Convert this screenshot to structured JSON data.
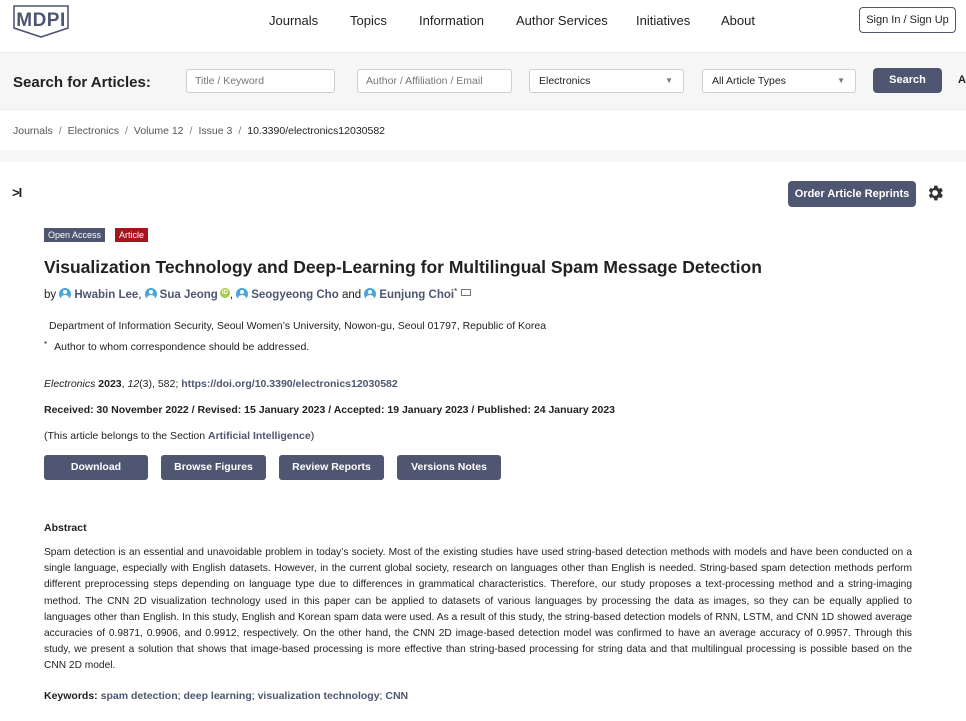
{
  "brand": {
    "logo_text": "MDPI",
    "accent": "#4f5671",
    "article_badge_color": "#a6141e"
  },
  "nav": {
    "items": [
      "Journals",
      "Topics",
      "Information",
      "Author Services",
      "Initiatives",
      "About"
    ],
    "signin": "Sign In / Sign Up"
  },
  "search": {
    "label": "Search for Articles:",
    "title_placeholder": "Title / Keyword",
    "author_placeholder": "Author / Affiliation / Email",
    "journal_value": "Electronics",
    "type_value": "All Article Types",
    "button": "Search",
    "cutoff": "A"
  },
  "breadcrumb": [
    "Journals",
    "Electronics",
    "Volume 12",
    "Issue 3",
    "10.3390/electronics12030582"
  ],
  "tools": {
    "toggle": ">I",
    "order_reprints": "Order Article Reprints"
  },
  "badges": {
    "open_access": "Open Access",
    "type": "Article"
  },
  "article": {
    "title": "Visualization Technology and Deep-Learning for Multilingual Spam Message Detection",
    "by": "by",
    "authors": [
      "Hwabin Lee",
      "Sua Jeong",
      "Seogyeong Cho",
      "Eunjung Choi"
    ],
    "and": "and",
    "corr_mark": "*",
    "orcid_mark": "iD",
    "affiliation": "Department of Information Security, Seoul Women’s University, Nowon-gu, Seoul 01797, Republic of Korea",
    "correspondence": "Author to whom correspondence should be addressed.",
    "citation": {
      "journal": "Electronics",
      "year": "2023",
      "volume": "12",
      "issue_pages": "(3), 582;",
      "doi": "https://doi.org/10.3390/electronics12030582"
    },
    "dates": "Received: 30 November 2022 / Revised: 15 January 2023 / Accepted: 19 January 2023 / Published: 24 January 2023",
    "section_prefix": "(This article belongs to the Section ",
    "section_name": "Artificial Intelligence",
    "section_suffix": ")"
  },
  "buttons": [
    "Download",
    "Browse Figures",
    "Review Reports",
    "Versions Notes"
  ],
  "abstract": {
    "heading": "Abstract",
    "text": "Spam detection is an essential and unavoidable problem in today’s society. Most of the existing studies have used string-based detection methods with models and have been conducted on a single language, especially with English datasets. However, in the current global society, research on languages other than English is needed. String-based spam detection methods perform different preprocessing steps depending on language type due to differences in grammatical characteristics. Therefore, our study proposes a text-processing method and a string-imaging method. The CNN 2D visualization technology used in this paper can be applied to datasets of various languages by processing the data as images, so they can be equally applied to languages other than English. In this study, English and Korean spam data were used. As a result of this study, the string-based detection models of RNN, LSTM, and CNN 1D showed average accuracies of 0.9871, 0.9906, and 0.9912, respectively. On the other hand, the CNN 2D image-based detection model was confirmed to have an average accuracy of 0.9957. Through this study, we present a solution that shows that image-based processing is more effective than string-based processing for string data and that multilingual processing is possible based on the CNN 2D model."
  },
  "keywords": {
    "label": "Keywords:",
    "items": [
      "spam detection",
      "deep learning",
      "visualization technology",
      "CNN"
    ]
  }
}
